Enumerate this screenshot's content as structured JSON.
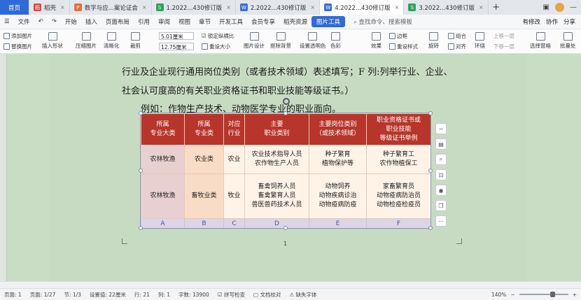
{
  "tabs": [
    {
      "label": "首页",
      "kind": "home"
    },
    {
      "label": "稻壳",
      "icon_color": "#e0433a",
      "icon_glyph": "稻"
    },
    {
      "label": "数字与应...案论证会",
      "icon_color": "#e0703a",
      "icon_glyph": "P"
    },
    {
      "label": "1.2022...430修订版",
      "icon_color": "#2aa55a",
      "icon_glyph": "S"
    },
    {
      "label": "2.2022...430修订版",
      "icon_color": "#3b6fd8",
      "icon_glyph": "W"
    },
    {
      "label": "4.2022...430修订版",
      "icon_color": "#3b6fd8",
      "icon_glyph": "W",
      "active": true
    },
    {
      "label": "3.2022...430修订版",
      "icon_color": "#2aa55a",
      "icon_glyph": "S"
    }
  ],
  "menubar": {
    "file": "文件",
    "items": [
      "开始",
      "插入",
      "页面布局",
      "引用",
      "审阅",
      "视图",
      "章节",
      "开发工具",
      "会员专享",
      "稻壳资源"
    ],
    "picture_tool": "图片工具",
    "search": "查找命令、搜索模板",
    "right": [
      "有修改",
      "协作",
      "分享"
    ]
  },
  "ribbon": {
    "add_picture": "添加图片",
    "replace_picture": "替换图片",
    "insert_shape": "插入形状",
    "compress": "压缩图片",
    "clarify": "清晰化",
    "crop": "裁剪",
    "width": "5.01厘米",
    "height": "12.75厘米",
    "lock_ratio": "锁定纵横比",
    "reset_size": "重设大小",
    "pic_design": "图片设计",
    "cutout": "抠除背景",
    "transparent": "设置透明色",
    "color": "色彩",
    "effect": "效果",
    "reset_style": "重设样式",
    "border": "边框",
    "rotate": "旋转",
    "combine": "组合",
    "align": "对齐",
    "wrap": "环绕",
    "up_layer": "上移一层",
    "down_layer": "下移一层",
    "select_pane": "选择窗格",
    "batch": "批量处"
  },
  "document": {
    "line1": "行业及企业现行通用岗位类别（或者技术领域）表述填写；F 列:列举行业、企业、",
    "line2": "社会认可度高的有关职业资格证书和职业技能等级证书。）",
    "line3": "例如：作物生产技术、动物医学专业的职业面向。",
    "page_number": "1"
  },
  "table": {
    "headers": [
      [
        "所属",
        "专业大类"
      ],
      [
        "所属",
        "专业类"
      ],
      [
        "对应",
        "行业"
      ],
      [
        "主要",
        "职业类别"
      ],
      [
        "主要岗位类别",
        "（或技术领域）"
      ],
      [
        "职业资格证书或",
        "职业技能",
        "等级证书举例"
      ]
    ],
    "rows": [
      [
        [
          "农林牧渔"
        ],
        [
          "农业类"
        ],
        [
          "农业"
        ],
        [
          "农业技术指导人员",
          "农作物生产人员"
        ],
        [
          "种子繁育",
          "植物保护等"
        ],
        [
          "种子繁育工",
          "农作物植保工"
        ]
      ],
      [
        [
          "农林牧渔"
        ],
        [
          "畜牧业类"
        ],
        [
          "牧业"
        ],
        [
          "畜禽饲养人员",
          "畜禽繁育人员",
          "兽医兽药技术人员"
        ],
        [
          "动物饲养",
          "动物疾病诊治",
          "动物疫病防疫"
        ],
        [
          "家畜繁育员",
          "动物疫病防治员",
          "动物检疫检疫员"
        ]
      ]
    ],
    "column_letters": [
      "A",
      "B",
      "C",
      "D",
      "E",
      "F"
    ]
  },
  "status": {
    "page": "页面: 1",
    "pages": "页面: 1/27",
    "section": "节: 1/3",
    "setting": "设置值: 22厘米",
    "row": "行: 21",
    "col": "列: 1",
    "wordcount": "字数: 13900",
    "spell": "拼写检查",
    "proof": "文档校对",
    "font_missing": "缺失字体",
    "zoom": "140%"
  }
}
